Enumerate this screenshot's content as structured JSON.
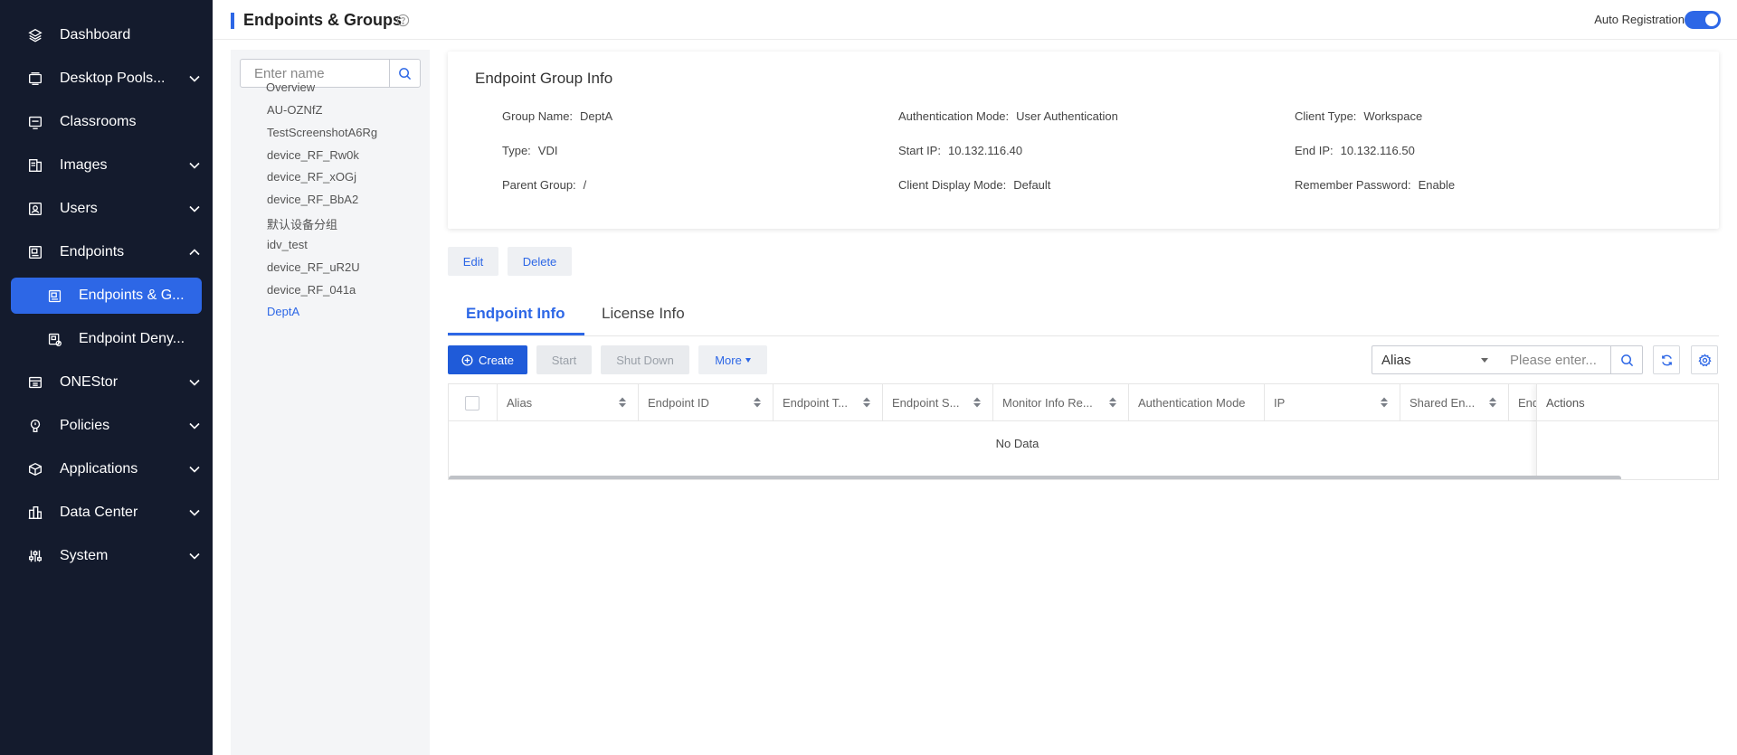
{
  "sidebar": {
    "items": [
      {
        "label": "Dashboard",
        "icon": "layers-icon"
      },
      {
        "label": "Desktop Pools...",
        "icon": "desktop-pool-icon"
      },
      {
        "label": "Classrooms",
        "icon": "classroom-icon"
      },
      {
        "label": "Images",
        "icon": "image-icon"
      },
      {
        "label": "Users",
        "icon": "user-icon"
      },
      {
        "label": "Endpoints",
        "icon": "endpoint-icon"
      },
      {
        "label": "ONEStor",
        "icon": "storage-icon"
      },
      {
        "label": "Policies",
        "icon": "policy-icon"
      },
      {
        "label": "Applications",
        "icon": "application-icon"
      },
      {
        "label": "Data Center",
        "icon": "data-center-icon"
      },
      {
        "label": "System",
        "icon": "system-icon"
      }
    ],
    "sub_items": [
      {
        "label": "Endpoints & G...",
        "icon": "endpoint-group-icon"
      },
      {
        "label": "Endpoint Deny...",
        "icon": "endpoint-deny-icon"
      }
    ]
  },
  "header": {
    "title": "Endpoints & Groups",
    "auto_registration_label": "Auto Registration",
    "auto_registration_on": true
  },
  "groups": {
    "search_placeholder": "Enter name",
    "items": [
      "Overview",
      "AU-OZNfZ",
      "TestScreenshotA6Rg",
      "device_RF_Rw0k",
      "device_RF_xOGj",
      "device_RF_BbA2",
      "默认设备分组",
      "idv_test",
      "device_RF_uR2U",
      "device_RF_041a",
      "DeptA"
    ],
    "selected": "DeptA"
  },
  "group_info": {
    "title": "Endpoint Group Info",
    "fields": [
      {
        "key": "Group Name:",
        "value": "DeptA"
      },
      {
        "key": "Authentication Mode:",
        "value": "User Authentication"
      },
      {
        "key": "Client Type:",
        "value": "Workspace"
      },
      {
        "key": "Type:",
        "value": "VDI"
      },
      {
        "key": "Start IP:",
        "value": "10.132.116.40"
      },
      {
        "key": "End IP:",
        "value": "10.132.116.50"
      },
      {
        "key": "Parent Group:",
        "value": "/"
      },
      {
        "key": "Client Display Mode:",
        "value": "Default"
      },
      {
        "key": "Remember Password:",
        "value": "Enable"
      }
    ],
    "edit_label": "Edit",
    "delete_label": "Delete"
  },
  "tabs": [
    {
      "label": "Endpoint Info",
      "active": true
    },
    {
      "label": "License Info",
      "active": false
    }
  ],
  "toolbar": {
    "create_label": "Create",
    "start_label": "Start",
    "shutdown_label": "Shut Down",
    "more_label": "More",
    "filter_selected": "Alias",
    "filter_placeholder": "Please enter..."
  },
  "table": {
    "columns": [
      "Alias",
      "Endpoint ID",
      "Endpoint T...",
      "Endpoint S...",
      "Monitor Info Re...",
      "Authentication Mode",
      "IP",
      "Shared En...",
      "End"
    ],
    "actions_label": "Actions",
    "empty_text": "No Data"
  },
  "colors": {
    "sidebar_bg": "#141b2d",
    "accent": "#2d67e6",
    "primary_button": "#1f5bd9"
  }
}
